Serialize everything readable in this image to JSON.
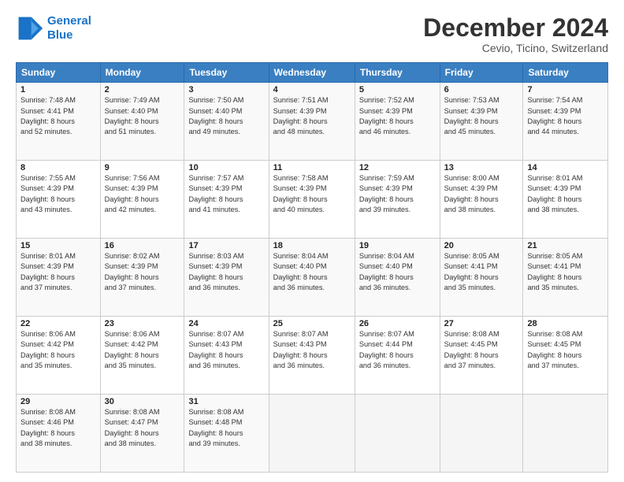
{
  "header": {
    "logo_line1": "General",
    "logo_line2": "Blue",
    "month": "December 2024",
    "location": "Cevio, Ticino, Switzerland"
  },
  "columns": [
    "Sunday",
    "Monday",
    "Tuesday",
    "Wednesday",
    "Thursday",
    "Friday",
    "Saturday"
  ],
  "weeks": [
    [
      {
        "day": "1",
        "info": "Sunrise: 7:48 AM\nSunset: 4:41 PM\nDaylight: 8 hours\nand 52 minutes."
      },
      {
        "day": "2",
        "info": "Sunrise: 7:49 AM\nSunset: 4:40 PM\nDaylight: 8 hours\nand 51 minutes."
      },
      {
        "day": "3",
        "info": "Sunrise: 7:50 AM\nSunset: 4:40 PM\nDaylight: 8 hours\nand 49 minutes."
      },
      {
        "day": "4",
        "info": "Sunrise: 7:51 AM\nSunset: 4:39 PM\nDaylight: 8 hours\nand 48 minutes."
      },
      {
        "day": "5",
        "info": "Sunrise: 7:52 AM\nSunset: 4:39 PM\nDaylight: 8 hours\nand 46 minutes."
      },
      {
        "day": "6",
        "info": "Sunrise: 7:53 AM\nSunset: 4:39 PM\nDaylight: 8 hours\nand 45 minutes."
      },
      {
        "day": "7",
        "info": "Sunrise: 7:54 AM\nSunset: 4:39 PM\nDaylight: 8 hours\nand 44 minutes."
      }
    ],
    [
      {
        "day": "8",
        "info": "Sunrise: 7:55 AM\nSunset: 4:39 PM\nDaylight: 8 hours\nand 43 minutes."
      },
      {
        "day": "9",
        "info": "Sunrise: 7:56 AM\nSunset: 4:39 PM\nDaylight: 8 hours\nand 42 minutes."
      },
      {
        "day": "10",
        "info": "Sunrise: 7:57 AM\nSunset: 4:39 PM\nDaylight: 8 hours\nand 41 minutes."
      },
      {
        "day": "11",
        "info": "Sunrise: 7:58 AM\nSunset: 4:39 PM\nDaylight: 8 hours\nand 40 minutes."
      },
      {
        "day": "12",
        "info": "Sunrise: 7:59 AM\nSunset: 4:39 PM\nDaylight: 8 hours\nand 39 minutes."
      },
      {
        "day": "13",
        "info": "Sunrise: 8:00 AM\nSunset: 4:39 PM\nDaylight: 8 hours\nand 38 minutes."
      },
      {
        "day": "14",
        "info": "Sunrise: 8:01 AM\nSunset: 4:39 PM\nDaylight: 8 hours\nand 38 minutes."
      }
    ],
    [
      {
        "day": "15",
        "info": "Sunrise: 8:01 AM\nSunset: 4:39 PM\nDaylight: 8 hours\nand 37 minutes."
      },
      {
        "day": "16",
        "info": "Sunrise: 8:02 AM\nSunset: 4:39 PM\nDaylight: 8 hours\nand 37 minutes."
      },
      {
        "day": "17",
        "info": "Sunrise: 8:03 AM\nSunset: 4:39 PM\nDaylight: 8 hours\nand 36 minutes."
      },
      {
        "day": "18",
        "info": "Sunrise: 8:04 AM\nSunset: 4:40 PM\nDaylight: 8 hours\nand 36 minutes."
      },
      {
        "day": "19",
        "info": "Sunrise: 8:04 AM\nSunset: 4:40 PM\nDaylight: 8 hours\nand 36 minutes."
      },
      {
        "day": "20",
        "info": "Sunrise: 8:05 AM\nSunset: 4:41 PM\nDaylight: 8 hours\nand 35 minutes."
      },
      {
        "day": "21",
        "info": "Sunrise: 8:05 AM\nSunset: 4:41 PM\nDaylight: 8 hours\nand 35 minutes."
      }
    ],
    [
      {
        "day": "22",
        "info": "Sunrise: 8:06 AM\nSunset: 4:42 PM\nDaylight: 8 hours\nand 35 minutes."
      },
      {
        "day": "23",
        "info": "Sunrise: 8:06 AM\nSunset: 4:42 PM\nDaylight: 8 hours\nand 35 minutes."
      },
      {
        "day": "24",
        "info": "Sunrise: 8:07 AM\nSunset: 4:43 PM\nDaylight: 8 hours\nand 36 minutes."
      },
      {
        "day": "25",
        "info": "Sunrise: 8:07 AM\nSunset: 4:43 PM\nDaylight: 8 hours\nand 36 minutes."
      },
      {
        "day": "26",
        "info": "Sunrise: 8:07 AM\nSunset: 4:44 PM\nDaylight: 8 hours\nand 36 minutes."
      },
      {
        "day": "27",
        "info": "Sunrise: 8:08 AM\nSunset: 4:45 PM\nDaylight: 8 hours\nand 37 minutes."
      },
      {
        "day": "28",
        "info": "Sunrise: 8:08 AM\nSunset: 4:45 PM\nDaylight: 8 hours\nand 37 minutes."
      }
    ],
    [
      {
        "day": "29",
        "info": "Sunrise: 8:08 AM\nSunset: 4:46 PM\nDaylight: 8 hours\nand 38 minutes."
      },
      {
        "day": "30",
        "info": "Sunrise: 8:08 AM\nSunset: 4:47 PM\nDaylight: 8 hours\nand 38 minutes."
      },
      {
        "day": "31",
        "info": "Sunrise: 8:08 AM\nSunset: 4:48 PM\nDaylight: 8 hours\nand 39 minutes."
      },
      null,
      null,
      null,
      null
    ]
  ]
}
